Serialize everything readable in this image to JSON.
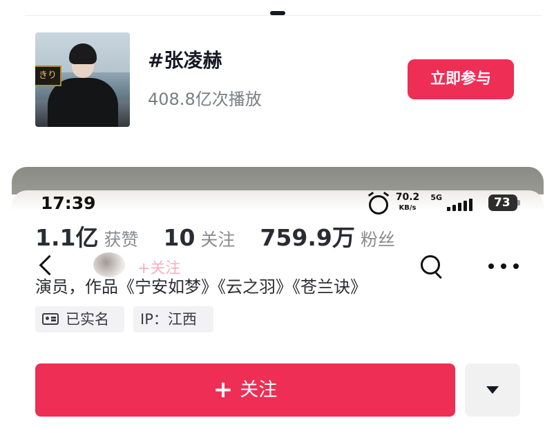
{
  "topic": {
    "title": "#张凌赫",
    "plays": "408.8亿次播放",
    "join_label": "立即参与",
    "thumb_sign": "きり"
  },
  "status_bar": {
    "time": "17:39",
    "net_speed": "70.2",
    "net_unit": "KB/s",
    "network": "5G",
    "battery": "73"
  },
  "profile": {
    "stats": [
      {
        "value": "1.1亿",
        "label": "获赞"
      },
      {
        "value": "10",
        "label": "关注"
      },
      {
        "value": "759.9万",
        "label": "粉丝"
      }
    ],
    "ghost_follow_label": "+关注",
    "bio": "演员，作品《宁安如梦》《云之羽》《苍兰诀》",
    "tags": {
      "verified": "已实名",
      "ip": "IP：江西"
    },
    "follow_label": "关注",
    "follow_plus": "+"
  },
  "icons": [
    "alarm-icon",
    "signal-icon",
    "battery-icon",
    "back-icon",
    "search-icon",
    "more-icon",
    "id-card-icon",
    "chevron-down-icon"
  ],
  "colors": {
    "accent": "#ee2e55",
    "text_primary": "#161823",
    "text_secondary": "#7a7c83"
  }
}
